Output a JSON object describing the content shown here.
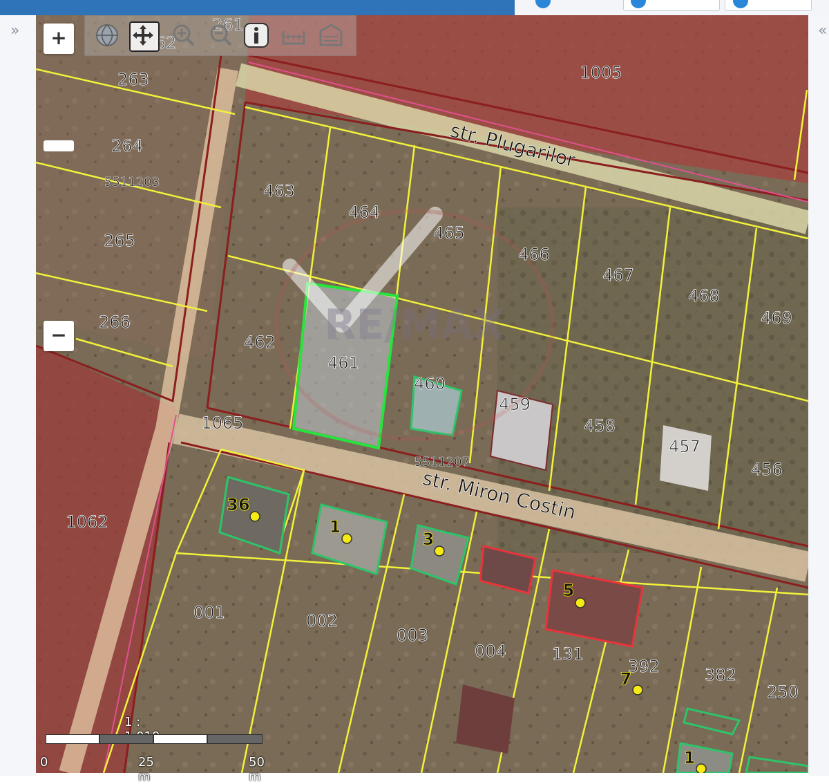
{
  "scale": {
    "ratio": "1 : 1.019",
    "ticks": [
      "0",
      "25 m",
      "50 m"
    ]
  },
  "streets": [
    "str. Plugarilor",
    "str. Miron Costin"
  ],
  "parcels_top": [
    "263",
    "264",
    "265",
    "266",
    "1005",
    "463",
    "464",
    "465",
    "466",
    "467",
    "468",
    "469",
    "462",
    "461",
    "460",
    "459",
    "458",
    "457",
    "456",
    "1065",
    "1062"
  ],
  "parcels_bottom": [
    "001",
    "002",
    "003",
    "004",
    "131",
    "392",
    "382",
    "250"
  ],
  "cadastral_codes": [
    "5511203",
    "5511207"
  ],
  "house_numbers": [
    "36",
    "1",
    "3",
    "5",
    "7",
    "1"
  ],
  "partial_labels": [
    "261",
    "62"
  ],
  "watermark": "RE/MAX",
  "controls": {
    "zoom_in": "+",
    "zoom_out": "−",
    "expand_left": "»",
    "expand_right": "«"
  },
  "colors": {
    "parcel_line": "#f2f23a",
    "boundary_red": "#8b1e1e",
    "highlight_green": "#27e33d",
    "building_red": "#e8343a",
    "address_point": "#f5ea14"
  }
}
